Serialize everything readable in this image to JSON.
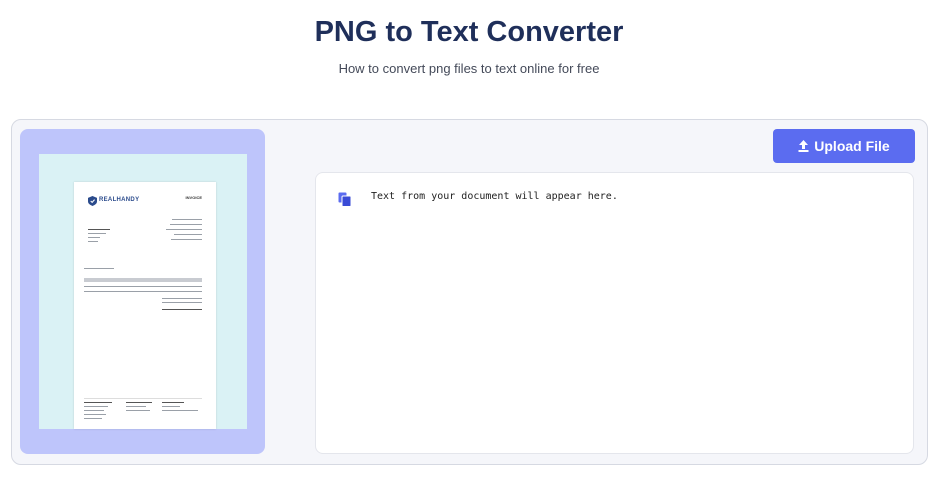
{
  "header": {
    "title": "PNG to Text Converter",
    "subtitle": "How to convert png files to text online for free"
  },
  "preview": {
    "logo_text": "REALHANDY",
    "doc_label": "INVOICE"
  },
  "toolbar": {
    "upload_label": "Upload File",
    "upload_icon": "upload-arrow-icon"
  },
  "output": {
    "placeholder": "Text from your document will appear here.",
    "copy_icon": "copy-icon"
  },
  "colors": {
    "accent": "#5b6cf0",
    "title": "#1f2f5a",
    "preview_bg": "#bec5fb"
  }
}
